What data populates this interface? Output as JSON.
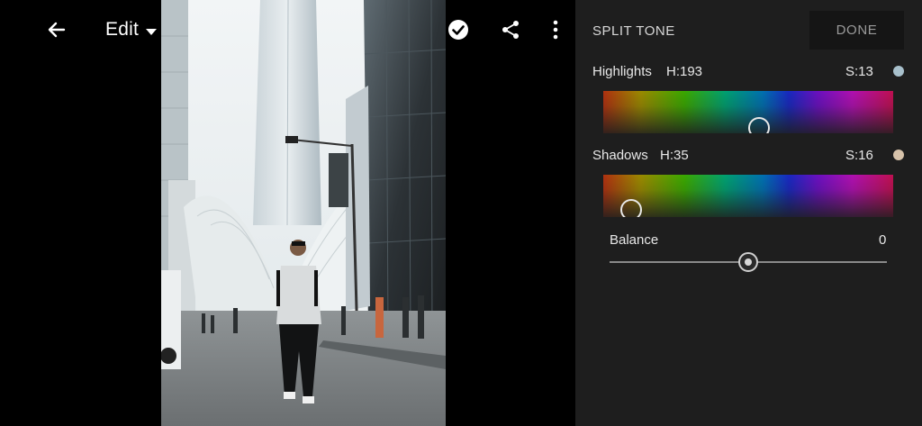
{
  "topbar": {
    "back_icon": "arrow-left-icon",
    "edit_label": "Edit",
    "undo_icon": "undo-icon",
    "help_icon": "help-icon",
    "check_icon": "check-circle-icon",
    "share_icon": "share-icon",
    "more_icon": "more-vertical-icon"
  },
  "panel": {
    "title": "SPLIT TONE",
    "done_label": "DONE",
    "highlights": {
      "label": "Highlights",
      "hue_text": "H:193",
      "sat_text": "S:13",
      "swatch_color": "#a8c0cc",
      "hue": 193,
      "saturation": 13
    },
    "shadows": {
      "label": "Shadows",
      "hue_text": "H:35",
      "sat_text": "S:16",
      "swatch_color": "#d6c2aa",
      "hue": 35,
      "saturation": 16
    },
    "balance": {
      "label": "Balance",
      "value_text": "0",
      "value": 0,
      "min": -100,
      "max": 100
    }
  },
  "colors": {
    "panel_bg": "#1e1e1e",
    "done_bg": "#151515"
  }
}
